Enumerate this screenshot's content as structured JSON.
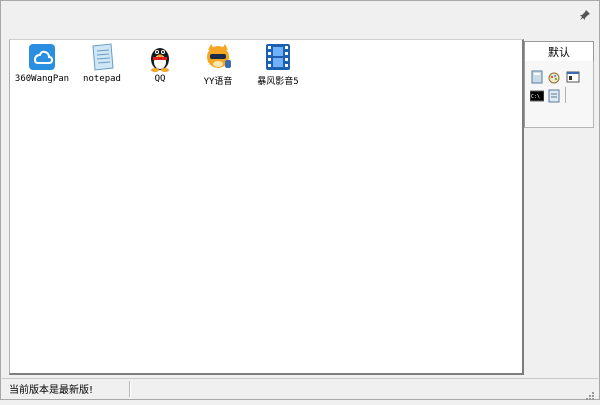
{
  "default_tab": "默认",
  "apps": [
    {
      "label": "360WangPan",
      "icon": "cloud-drive-icon"
    },
    {
      "label": "notepad",
      "icon": "notepad-icon"
    },
    {
      "label": "QQ",
      "icon": "penguin-icon"
    },
    {
      "label": "YY语音",
      "icon": "yy-voice-icon"
    },
    {
      "label": "暴风影音5",
      "icon": "film-strip-icon"
    }
  ],
  "side_icons": [
    "calculator-icon",
    "paint-icon",
    "window-icon",
    "command-prompt-icon",
    "document-icon"
  ],
  "status": {
    "message": "当前版本是最新版!"
  },
  "colors": {
    "background": "#f0f0f0",
    "panel": "#ffffff",
    "accent_blue": "#1e88e5"
  }
}
